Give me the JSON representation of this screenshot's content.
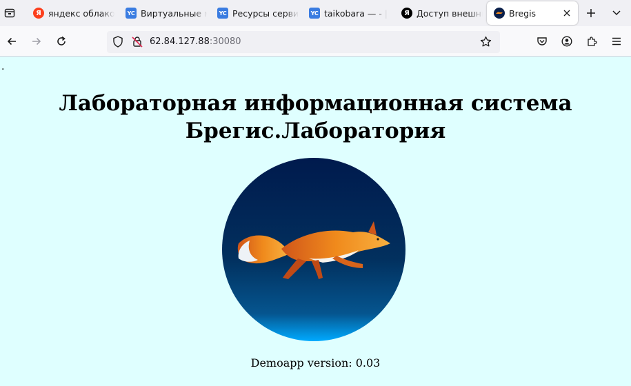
{
  "browser": {
    "tabs": [
      {
        "label": "яндекс облако",
        "favicon": "yandex-icon"
      },
      {
        "label": "Виртуальные машины",
        "favicon": "yandex-cloud-icon"
      },
      {
        "label": "Ресурсы сервиса",
        "favicon": "yandex-cloud-icon"
      },
      {
        "label": "taikobara — - |",
        "favicon": "yandex-cloud-icon"
      },
      {
        "label": "Доступ внешних",
        "favicon": "yandex-browser-icon"
      },
      {
        "label": "Bregis",
        "favicon": "bregis-fox-icon",
        "active": true
      }
    ],
    "favicon_text": {
      "yandex": "Я",
      "cloud": "YC"
    },
    "url": {
      "host": "62.84.127.88",
      "port": ":30080"
    }
  },
  "page": {
    "stray_text": ".",
    "heading_line1": "Лабораторная информационная система",
    "heading_line2": "Брегис.Лаборатория",
    "version": "Demoapp version: 0.03"
  },
  "colors": {
    "page_background": "#dfffff",
    "logo_top": "#001a4d",
    "logo_bottom": "#00aaff",
    "fox_orange": "#f08a1c"
  }
}
